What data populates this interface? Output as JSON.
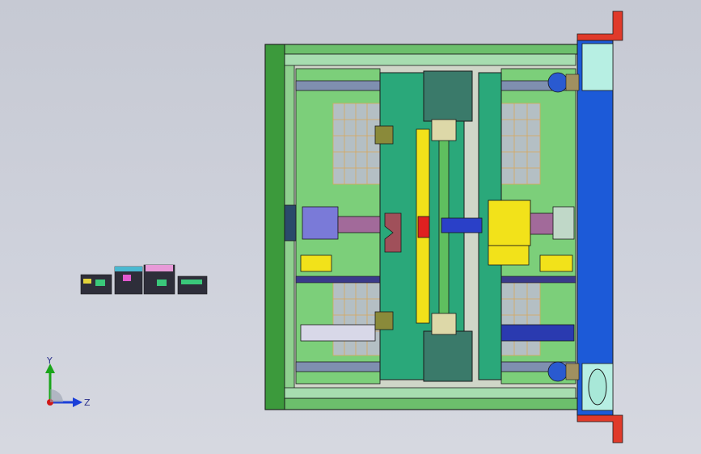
{
  "viewport": {
    "background": "#cfd2dc",
    "triad": {
      "y_label": "Y",
      "z_label": "Z",
      "y_color": "#1aa51a",
      "z_color": "#1b3fd8",
      "x_color": "#d01818"
    }
  },
  "model": {
    "frame_color": "#3c9a3c",
    "plate_color": "#2aa87a",
    "bracket_color": "#e03a2a",
    "panel_color": "#1c5ad8",
    "motor_color": "#f2e21a",
    "grid_color": "#d8a85a"
  }
}
